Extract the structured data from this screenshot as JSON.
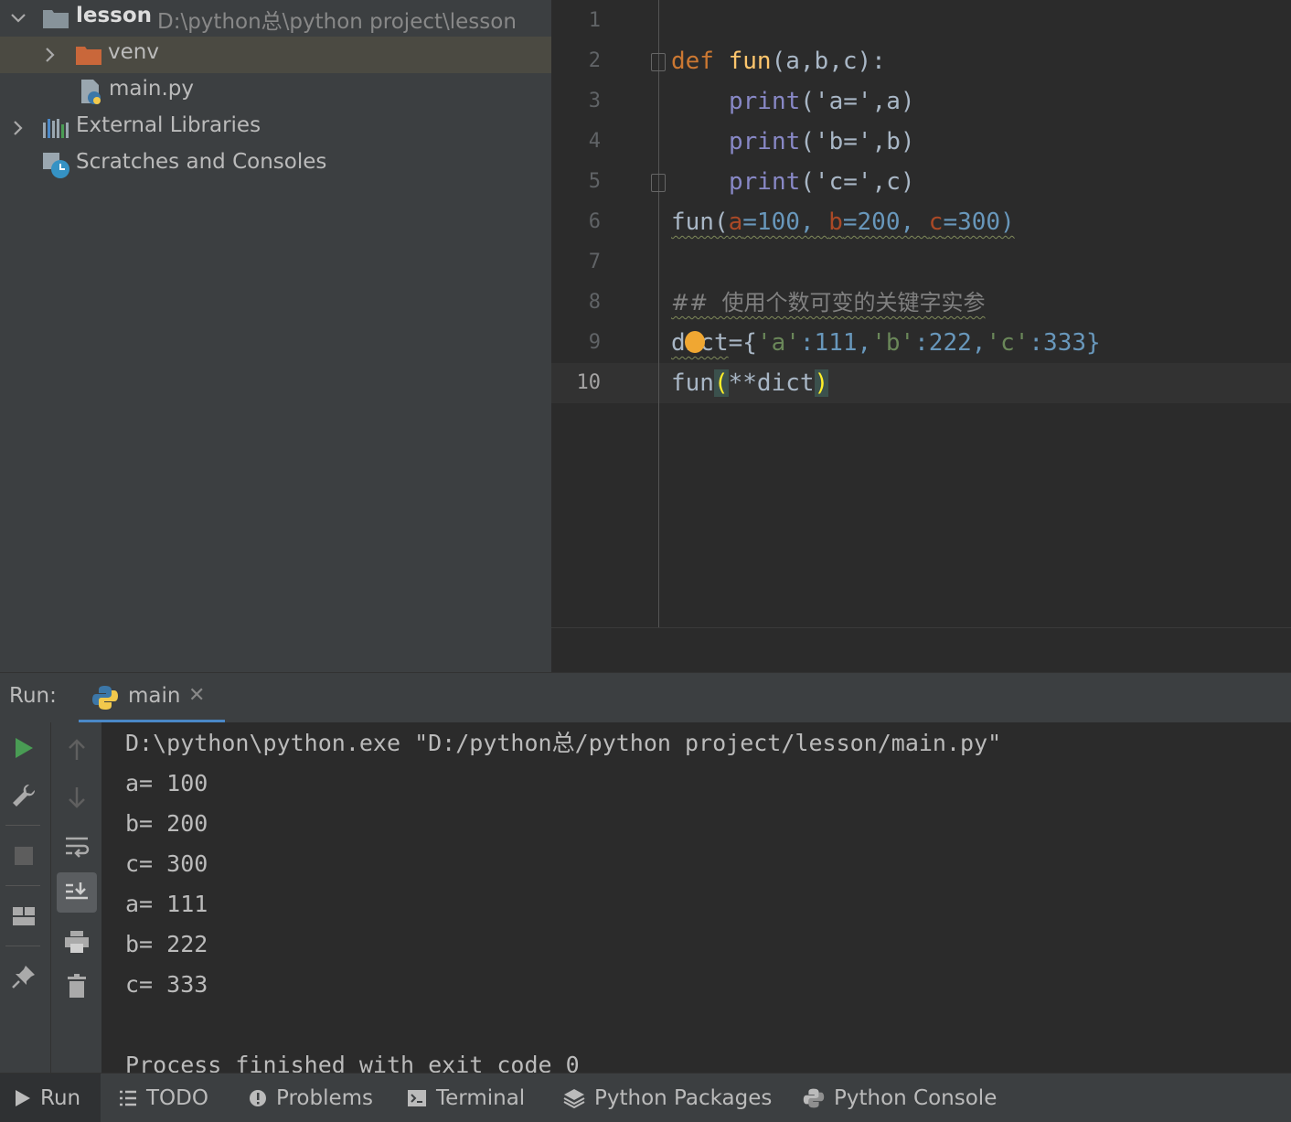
{
  "project_tree": {
    "root": {
      "name": "lesson",
      "path": "D:\\python总\\python project\\lesson"
    },
    "venv": "venv",
    "main_file": "main.py",
    "external_libraries": "External Libraries",
    "scratches": "Scratches and Consoles"
  },
  "editor": {
    "line_numbers": [
      "1",
      "2",
      "3",
      "4",
      "5",
      "6",
      "7",
      "8",
      "9",
      "10"
    ],
    "current_line": "10",
    "code": {
      "l2_def": "def",
      "l2_fun": "fun",
      "l2_rest": "(a,b,c):",
      "l3_print": "print",
      "l3_args": "('a=',a)",
      "l4_print": "print",
      "l4_args": "('b=',b)",
      "l5_print": "print",
      "l5_args": "('c=',c)",
      "l6_call": "fun(",
      "l6_a": "a",
      "l6_av": "=100, ",
      "l6_b": "b",
      "l6_bv": "=200, ",
      "l6_c": "c",
      "l6_cv": "=300)",
      "l8_comment": "##  使用个数可变的关键字实参",
      "l9_name": "dict",
      "l9_eq": "={",
      "l9_ka": "'a'",
      "l9_va": ":111,",
      "l9_kb": "'b'",
      "l9_vb": ":222,",
      "l9_kc": "'c'",
      "l9_vc": ":333}",
      "l10_fun": "fun",
      "l10_open": "(",
      "l10_arg": "**dict",
      "l10_close": ")"
    }
  },
  "run_panel": {
    "label": "Run:",
    "tab_label": "main",
    "output": [
      "D:\\python\\python.exe \"D:/python总/python project/lesson/main.py\"",
      "a= 100",
      "b= 200",
      "c= 300",
      "a= 111",
      "b= 222",
      "c= 333",
      "",
      "Process finished with exit code 0"
    ]
  },
  "bottom_tabs": {
    "run": "Run",
    "todo": "TODO",
    "problems": "Problems",
    "terminal": "Terminal",
    "python_packages": "Python Packages",
    "python_console": "Python Console"
  },
  "colors": {
    "keyword": "#cc7832",
    "function": "#ffc66d",
    "string": "#6a8759",
    "number": "#6897bb",
    "builtin": "#8888c6",
    "comment": "#808080",
    "run_green": "#499c54",
    "folder_orange": "#c9673a"
  },
  "icons": {
    "run": "play-icon",
    "settings": "wrench-icon",
    "stop": "stop-icon",
    "layout": "layout-icon",
    "pin": "pin-icon",
    "up": "arrow-up-icon",
    "down": "arrow-down-icon",
    "wrap": "soft-wrap-icon",
    "scroll": "scroll-to-end-icon",
    "print": "print-icon",
    "clear": "trash-icon"
  }
}
